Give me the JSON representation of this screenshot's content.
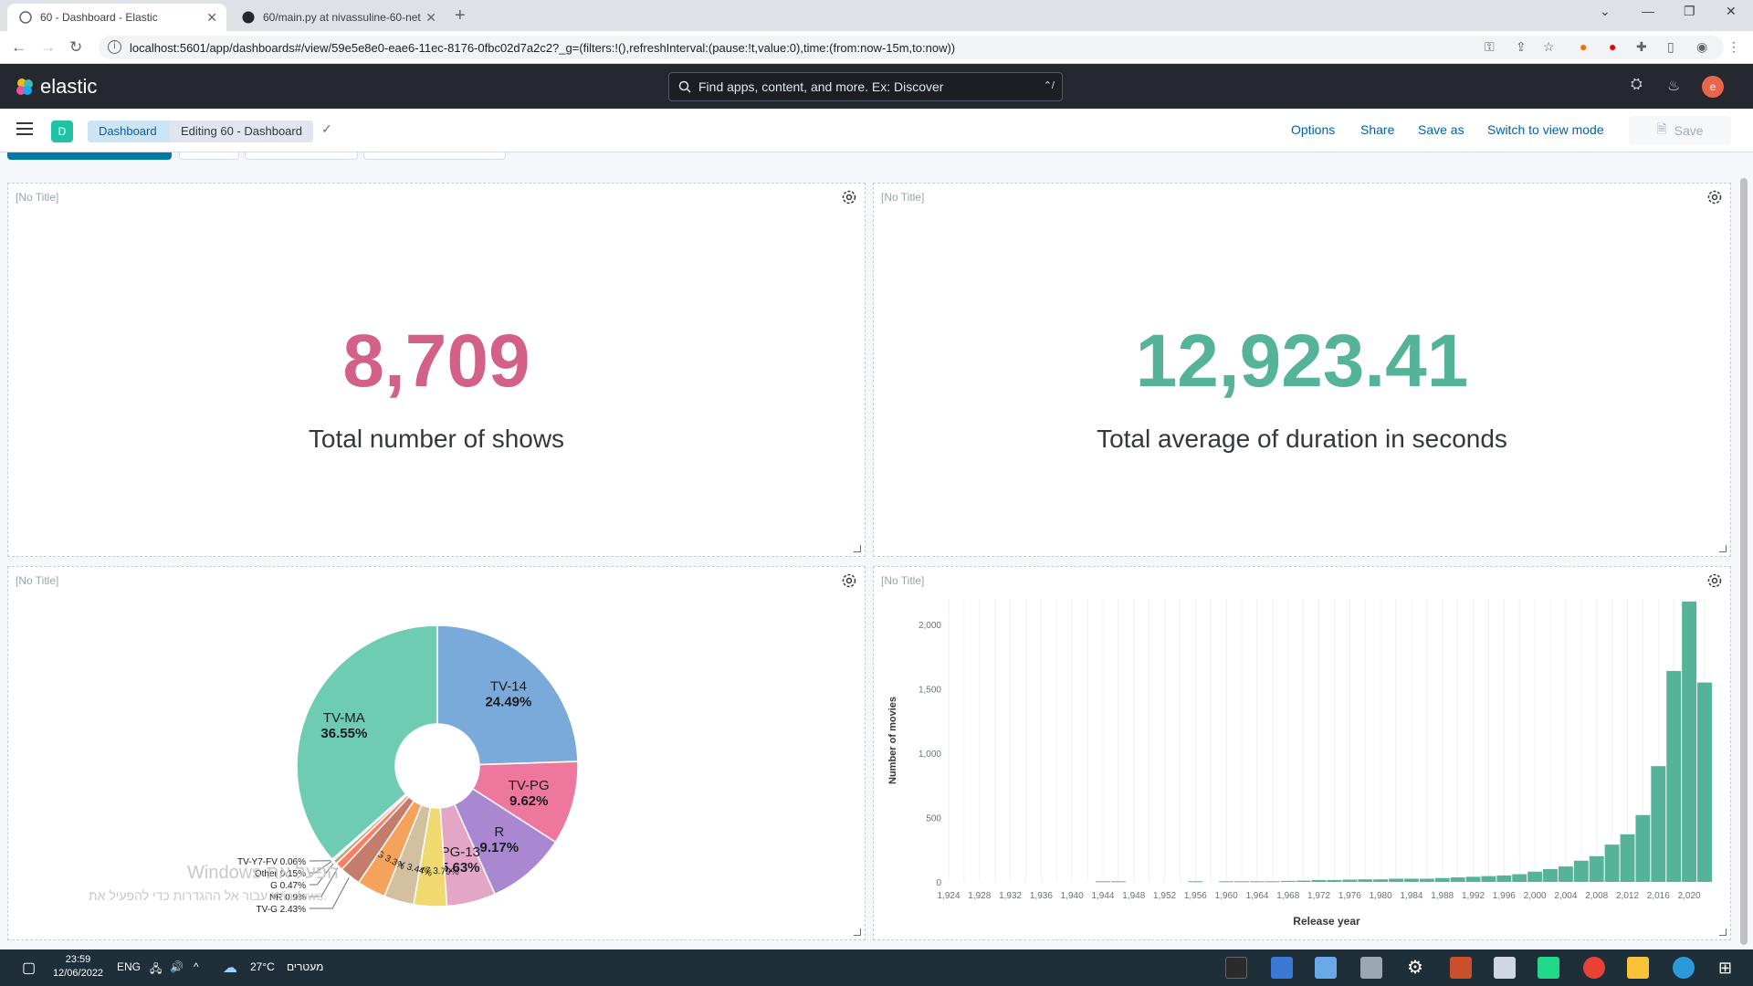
{
  "browser": {
    "tabs": [
      {
        "title": "60 - Dashboard - Elastic",
        "active": true
      },
      {
        "title": "60/main.py at nivassuline-60-net",
        "active": false
      }
    ],
    "url": "localhost:5601/app/dashboards#/view/59e5e8e0-eae6-11ec-8176-0fbc02d7a2c2?_g=(filters:!(),refreshInterval:(pause:!t,value:0),time:(from:now-15m,to:now))"
  },
  "header": {
    "brand": "elastic",
    "search_placeholder": "Find apps, content, and more. Ex: Discover",
    "search_shortcut": "⌃/",
    "avatar_letter": "e"
  },
  "subnav": {
    "space_badge": "D",
    "breadcrumb_root": "Dashboard",
    "breadcrumb_current": "Editing 60 - Dashboard",
    "options": "Options",
    "share": "Share",
    "save_as": "Save as",
    "switch_view": "Switch to view mode",
    "save": "Save"
  },
  "panels": {
    "p1": {
      "title": "[No Title]",
      "value": "8,709",
      "label": "Total number of shows",
      "color": "#d36086"
    },
    "p2": {
      "title": "[No Title]",
      "value": "12,923.41",
      "label": "Total average of duration in seconds",
      "color": "#54b399"
    },
    "p3": {
      "title": "[No Title]"
    },
    "p4": {
      "title": "[No Title]"
    }
  },
  "pie_chart": {
    "type": "pie",
    "slices": [
      {
        "label": "TV-14",
        "value": 24.49,
        "pct": "24.49%",
        "color": "#79aad9"
      },
      {
        "label": "TV-PG",
        "value": 9.62,
        "pct": "9.62%",
        "color": "#ee789d"
      },
      {
        "label": "R",
        "value": 9.17,
        "pct": "9.17%",
        "color": "#a987d1"
      },
      {
        "label": "PG-13",
        "value": 5.63,
        "pct": "5.63%",
        "color": "#e4a6c7"
      },
      {
        "label": "TV-Y7",
        "value": 3.79,
        "pct": "3.79%",
        "color": "#f1d86f"
      },
      {
        "label": "TV-Y",
        "value": 3.44,
        "pct": "3.44%",
        "color": "#d2c0a0"
      },
      {
        "label": "PG",
        "value": 3.3,
        "pct": "3.3%",
        "color": "#f5a35c"
      },
      {
        "label": "TV-G",
        "value": 2.43,
        "pct": "2.43%",
        "color": "#c47c6c"
      },
      {
        "label": "NR",
        "value": 0.9,
        "pct": "0.9%",
        "color": "#ff7e62"
      },
      {
        "label": "G",
        "value": 0.47,
        "pct": "0.47%",
        "color": "#b9a888"
      },
      {
        "label": "Other",
        "value": 0.15,
        "pct": "0.15%",
        "color": "#d6bf57"
      },
      {
        "label": "TV-Y7-FV",
        "value": 0.06,
        "pct": "0.06%",
        "color": "#aa6556"
      },
      {
        "label": "TV-MA",
        "value": 36.55,
        "pct": "36.55%",
        "color": "#6dccb1"
      }
    ]
  },
  "chart_data": {
    "type": "bar",
    "xlabel": "Release year",
    "ylabel": "Number of movies",
    "ylim": [
      0,
      2200
    ],
    "xlim": [
      1924,
      2022
    ],
    "x_ticks": [
      "1,924",
      "1,928",
      "1,932",
      "1,936",
      "1,940",
      "1,944",
      "1,948",
      "1,952",
      "1,956",
      "1,960",
      "1,964",
      "1,968",
      "1,972",
      "1,976",
      "1,980",
      "1,984",
      "1,988",
      "1,992",
      "1,996",
      "2,000",
      "2,004",
      "2,008",
      "2,012",
      "2,016",
      "2,020"
    ],
    "y_ticks": [
      "0",
      "500",
      "1,000",
      "1,500",
      "2,000"
    ],
    "y_tick_values": [
      0,
      500,
      1000,
      1500,
      2000
    ],
    "color": "#54b399",
    "grid": true,
    "bars": [
      {
        "x": 1944,
        "y": 5
      },
      {
        "x": 1946,
        "y": 5
      },
      {
        "x": 1956,
        "y": 5
      },
      {
        "x": 1960,
        "y": 5
      },
      {
        "x": 1962,
        "y": 5
      },
      {
        "x": 1964,
        "y": 5
      },
      {
        "x": 1966,
        "y": 5
      },
      {
        "x": 1968,
        "y": 8
      },
      {
        "x": 1970,
        "y": 10
      },
      {
        "x": 1972,
        "y": 15
      },
      {
        "x": 1974,
        "y": 15
      },
      {
        "x": 1976,
        "y": 18
      },
      {
        "x": 1978,
        "y": 20
      },
      {
        "x": 1980,
        "y": 20
      },
      {
        "x": 1982,
        "y": 25
      },
      {
        "x": 1984,
        "y": 25
      },
      {
        "x": 1986,
        "y": 25
      },
      {
        "x": 1988,
        "y": 30
      },
      {
        "x": 1990,
        "y": 35
      },
      {
        "x": 1992,
        "y": 40
      },
      {
        "x": 1994,
        "y": 45
      },
      {
        "x": 1996,
        "y": 50
      },
      {
        "x": 1998,
        "y": 60
      },
      {
        "x": 2000,
        "y": 80
      },
      {
        "x": 2002,
        "y": 100
      },
      {
        "x": 2004,
        "y": 120
      },
      {
        "x": 2006,
        "y": 165
      },
      {
        "x": 2008,
        "y": 200
      },
      {
        "x": 2010,
        "y": 290
      },
      {
        "x": 2012,
        "y": 370
      },
      {
        "x": 2014,
        "y": 520
      },
      {
        "x": 2016,
        "y": 900
      },
      {
        "x": 2018,
        "y": 1640
      },
      {
        "x": 2020,
        "y": 2180
      },
      {
        "x": 2022,
        "y": 1550
      }
    ]
  },
  "watermark": {
    "line1": "Windows הפעל את",
    "line2": "עבור אל ההגדרות כדי להפעיל את Windows."
  },
  "taskbar": {
    "time": "23:59",
    "date": "12/06/2022",
    "lang": "ENG",
    "weather_temp": "27°C",
    "weather_desc": "מעטרים"
  }
}
